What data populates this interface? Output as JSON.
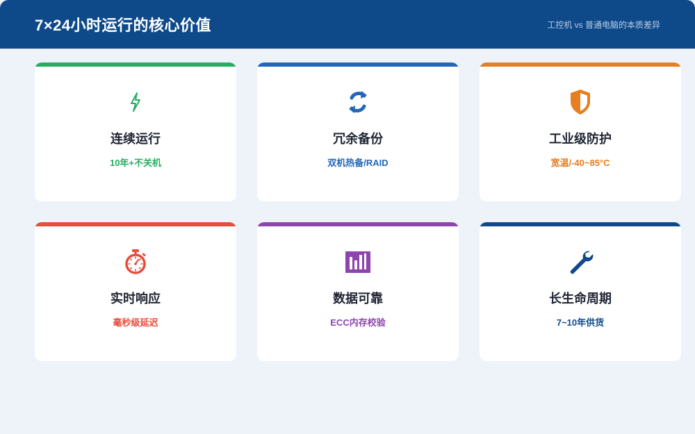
{
  "header": {
    "title": "7×24小时运行的核心价值",
    "subtitle": "工控机 vs 普通电脑的本质差异"
  },
  "cards": [
    {
      "name": "连续运行",
      "desc": "10年+不关机",
      "color": "#27ae60",
      "icon": "lightning-icon"
    },
    {
      "name": "冗余备份",
      "desc": "双机热备/RAID",
      "color": "#2166b8",
      "icon": "sync-icon"
    },
    {
      "name": "工业级防护",
      "desc": "宽温/-40~85°C",
      "color": "#e67e22",
      "icon": "shield-icon"
    },
    {
      "name": "实时响应",
      "desc": "毫秒级延迟",
      "color": "#e74c3c",
      "icon": "stopwatch-icon"
    },
    {
      "name": "数据可靠",
      "desc": "ECC内存校验",
      "color": "#8e44ad",
      "icon": "bar-chart-icon"
    },
    {
      "name": "长生命周期",
      "desc": "7~10年供货",
      "color": "#0e4a8a",
      "icon": "wrench-icon"
    }
  ]
}
